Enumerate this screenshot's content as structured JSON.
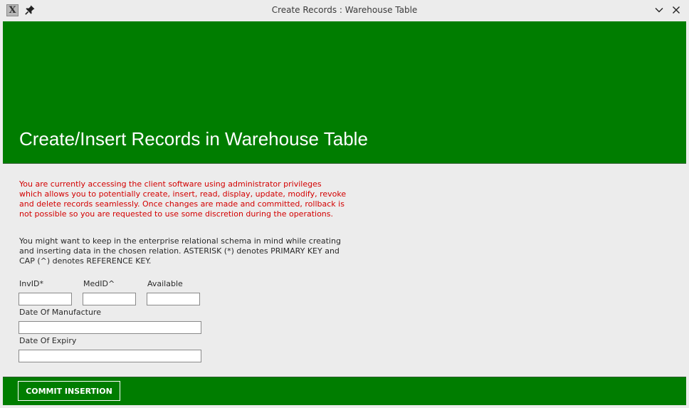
{
  "window": {
    "title": "Create Records : Warehouse Table",
    "app_icon": "X",
    "icons": [
      "x-app-icon",
      "pin-icon",
      "chevron-down-icon",
      "close-icon"
    ]
  },
  "header": {
    "heading": "Create/Insert Records in Warehouse Table",
    "background_color": "#007d00"
  },
  "notices": {
    "warning": "You are currently accessing the client software using administrator privileges which allows you to potentially create, insert, read, display, update, modify, revoke and delete records seamlessly. Once changes are made and committed, rollback is not possible so you are requested to use some discretion during the operations.",
    "warning_color": "#d30000",
    "info": "You might want to keep in the enterprise relational schema in mind while creating and inserting data in the chosen relation. ASTERISK (*) denotes PRIMARY KEY and CAP (^) denotes REFERENCE KEY."
  },
  "form": {
    "invid": {
      "label": "InvID*",
      "value": ""
    },
    "medid": {
      "label": "MedID^",
      "value": ""
    },
    "available": {
      "label": "Available",
      "value": ""
    },
    "date_of_manufacture": {
      "label": "Date Of Manufacture",
      "value": ""
    },
    "date_of_expiry": {
      "label": "Date Of Expiry",
      "value": ""
    }
  },
  "footer": {
    "commit_label": "COMMIT INSERTION"
  }
}
